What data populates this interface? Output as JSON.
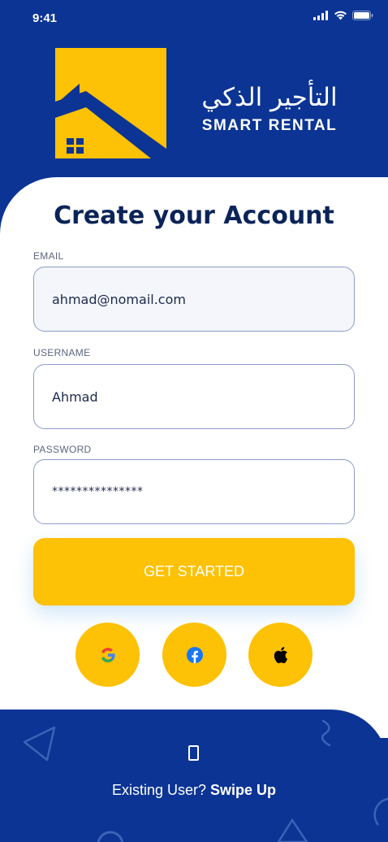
{
  "status_bar": {
    "time": "9:41",
    "icons": [
      "signal-icon",
      "wifi-icon",
      "battery-icon"
    ]
  },
  "brand": {
    "name_ar": "التأجير الذكي",
    "name_en": "SMART RENTAL",
    "colors": {
      "primary": "#0b3494",
      "accent": "#fdc105"
    }
  },
  "form": {
    "title": "Create your Account",
    "email": {
      "label": "EMAIL",
      "value": "ahmad@nomail.com"
    },
    "username": {
      "label": "USERNAME",
      "value": "Ahmad"
    },
    "password": {
      "label": "PASSWORD",
      "value": "***************"
    },
    "submit_label": "GET STARTED"
  },
  "social": [
    {
      "name": "google-icon"
    },
    {
      "name": "facebook-icon"
    },
    {
      "name": "apple-icon"
    }
  ],
  "footer": {
    "prompt": "Existing User?",
    "action": "Swipe Up",
    "icon": "phone-outline-icon"
  }
}
